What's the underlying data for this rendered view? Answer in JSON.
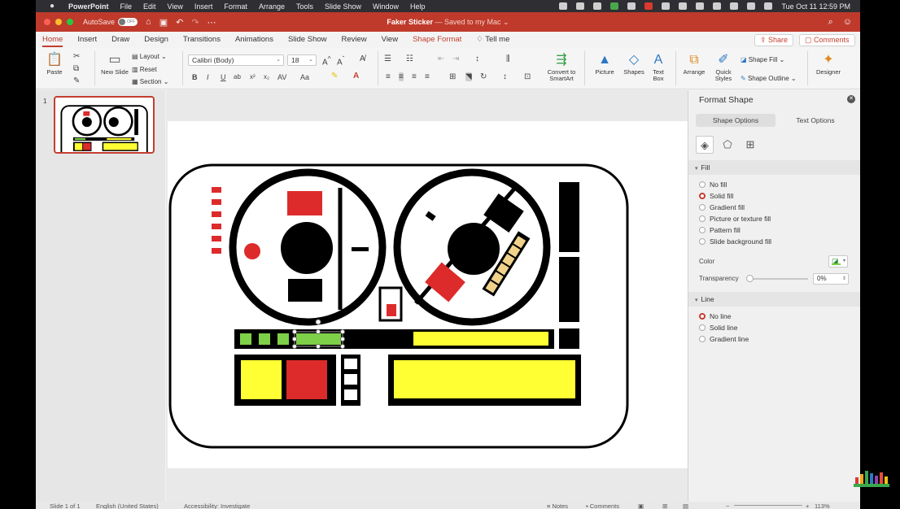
{
  "menubar": {
    "app": "PowerPoint",
    "items": [
      "File",
      "Edit",
      "View",
      "Insert",
      "Format",
      "Arrange",
      "Tools",
      "Slide Show",
      "Window",
      "Help"
    ],
    "clock": "Tue Oct 11  12:59 PM"
  },
  "titlebar": {
    "autosave_label": "AutoSave",
    "autosave_state": "OFF",
    "doc_name": "Faker Sticker",
    "doc_status": "— Saved to my Mac ⌄"
  },
  "ribbon_tabs": [
    "Home",
    "Insert",
    "Draw",
    "Design",
    "Transitions",
    "Animations",
    "Slide Show",
    "Review",
    "View",
    "Shape Format"
  ],
  "tell_me": "Tell me",
  "share_label": "Share",
  "comments_label": "Comments",
  "ribbon": {
    "paste": "Paste",
    "new_slide": "New Slide",
    "layout": "Layout",
    "reset": "Reset",
    "section": "Section",
    "font_name": "Calibri (Body)",
    "font_size": "18",
    "convert": "Convert to SmartArt",
    "picture": "Picture",
    "shapes": "Shapes",
    "textbox": "Text Box",
    "arrange": "Arrange",
    "quick_styles": "Quick Styles",
    "shape_fill": "Shape Fill",
    "shape_outline": "Shape Outline",
    "designer": "Designer"
  },
  "slides_pane": {
    "slide_number": "1"
  },
  "format_pane": {
    "title": "Format Shape",
    "subtabs": [
      "Shape Options",
      "Text Options"
    ],
    "fill_header": "Fill",
    "fill_options": [
      "No fill",
      "Solid fill",
      "Gradient fill",
      "Picture or texture fill",
      "Pattern fill",
      "Slide background fill"
    ],
    "fill_selected": 1,
    "color_label": "Color",
    "transparency_label": "Transparency",
    "transparency_value": "0%",
    "fill_color": "#7ed048",
    "line_header": "Line",
    "line_options": [
      "No line",
      "Solid line",
      "Gradient line"
    ],
    "line_selected": 0
  },
  "status": {
    "slide": "Slide 1 of 1",
    "language": "English (United States)",
    "accessibility": "Accessibility: Investigate",
    "notes": "Notes",
    "comments": "Comments",
    "zoom": "113%"
  },
  "colors": {
    "accent_red": "#c43e2f",
    "sticker_red": "#dd2b2b",
    "sticker_yellow": "#ffff33",
    "sticker_green": "#7ed048",
    "sticker_tan": "#f0d28a"
  }
}
